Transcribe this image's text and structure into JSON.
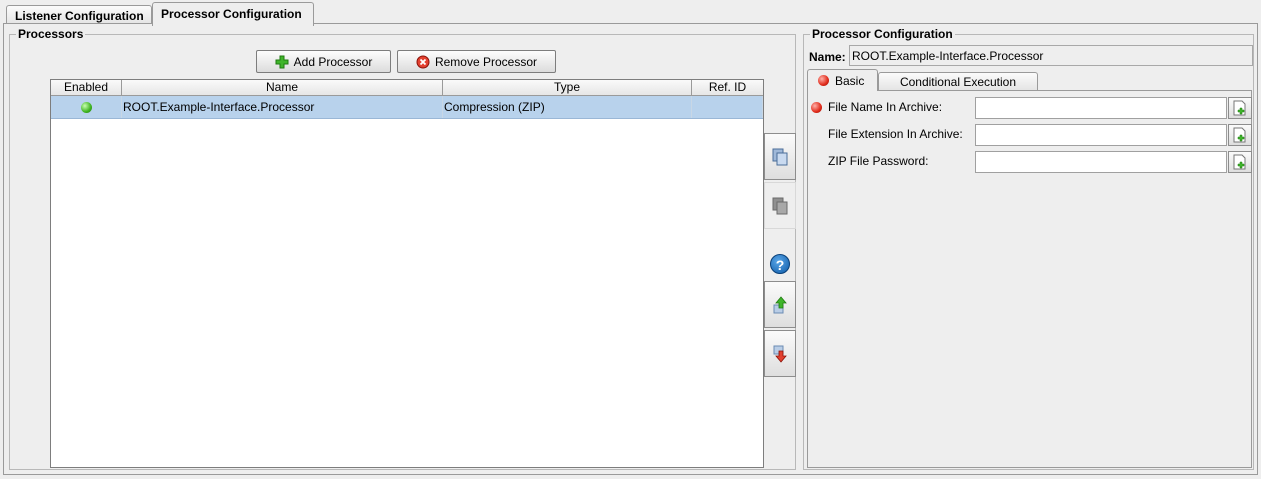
{
  "tabs": [
    {
      "label": "Listener Configuration",
      "active": false
    },
    {
      "label": "Processor Configuration",
      "active": true
    }
  ],
  "processors": {
    "title": "Processors",
    "add_label": "Add Processor",
    "remove_label": "Remove Processor",
    "columns": [
      "Enabled",
      "Name",
      "Type",
      "Ref. ID"
    ],
    "rows": [
      {
        "enabled": true,
        "name": "ROOT.Example-Interface.Processor",
        "type": "Compression (ZIP)",
        "ref_id": ""
      }
    ],
    "side_buttons": [
      "copy-icon",
      "paste-icon",
      "help-icon",
      "move-up-icon",
      "move-down-icon"
    ],
    "help_glyph": "?"
  },
  "config": {
    "title": "Processor Configuration",
    "name_label": "Name:",
    "name_value": "ROOT.Example-Interface.Processor",
    "tabs": [
      {
        "label": "Basic",
        "active": true,
        "error": true
      },
      {
        "label": "Conditional Execution",
        "active": false
      }
    ],
    "fields": [
      {
        "label": "File Name In Archive:",
        "value": "",
        "error": true
      },
      {
        "label": "File Extension In Archive:",
        "value": "",
        "error": false
      },
      {
        "label": "ZIP File Password:",
        "value": "",
        "error": false
      }
    ]
  },
  "colors": {
    "selection": "#b8d2ec",
    "enabled": "#3eb31f",
    "error": "#e02a1a"
  }
}
